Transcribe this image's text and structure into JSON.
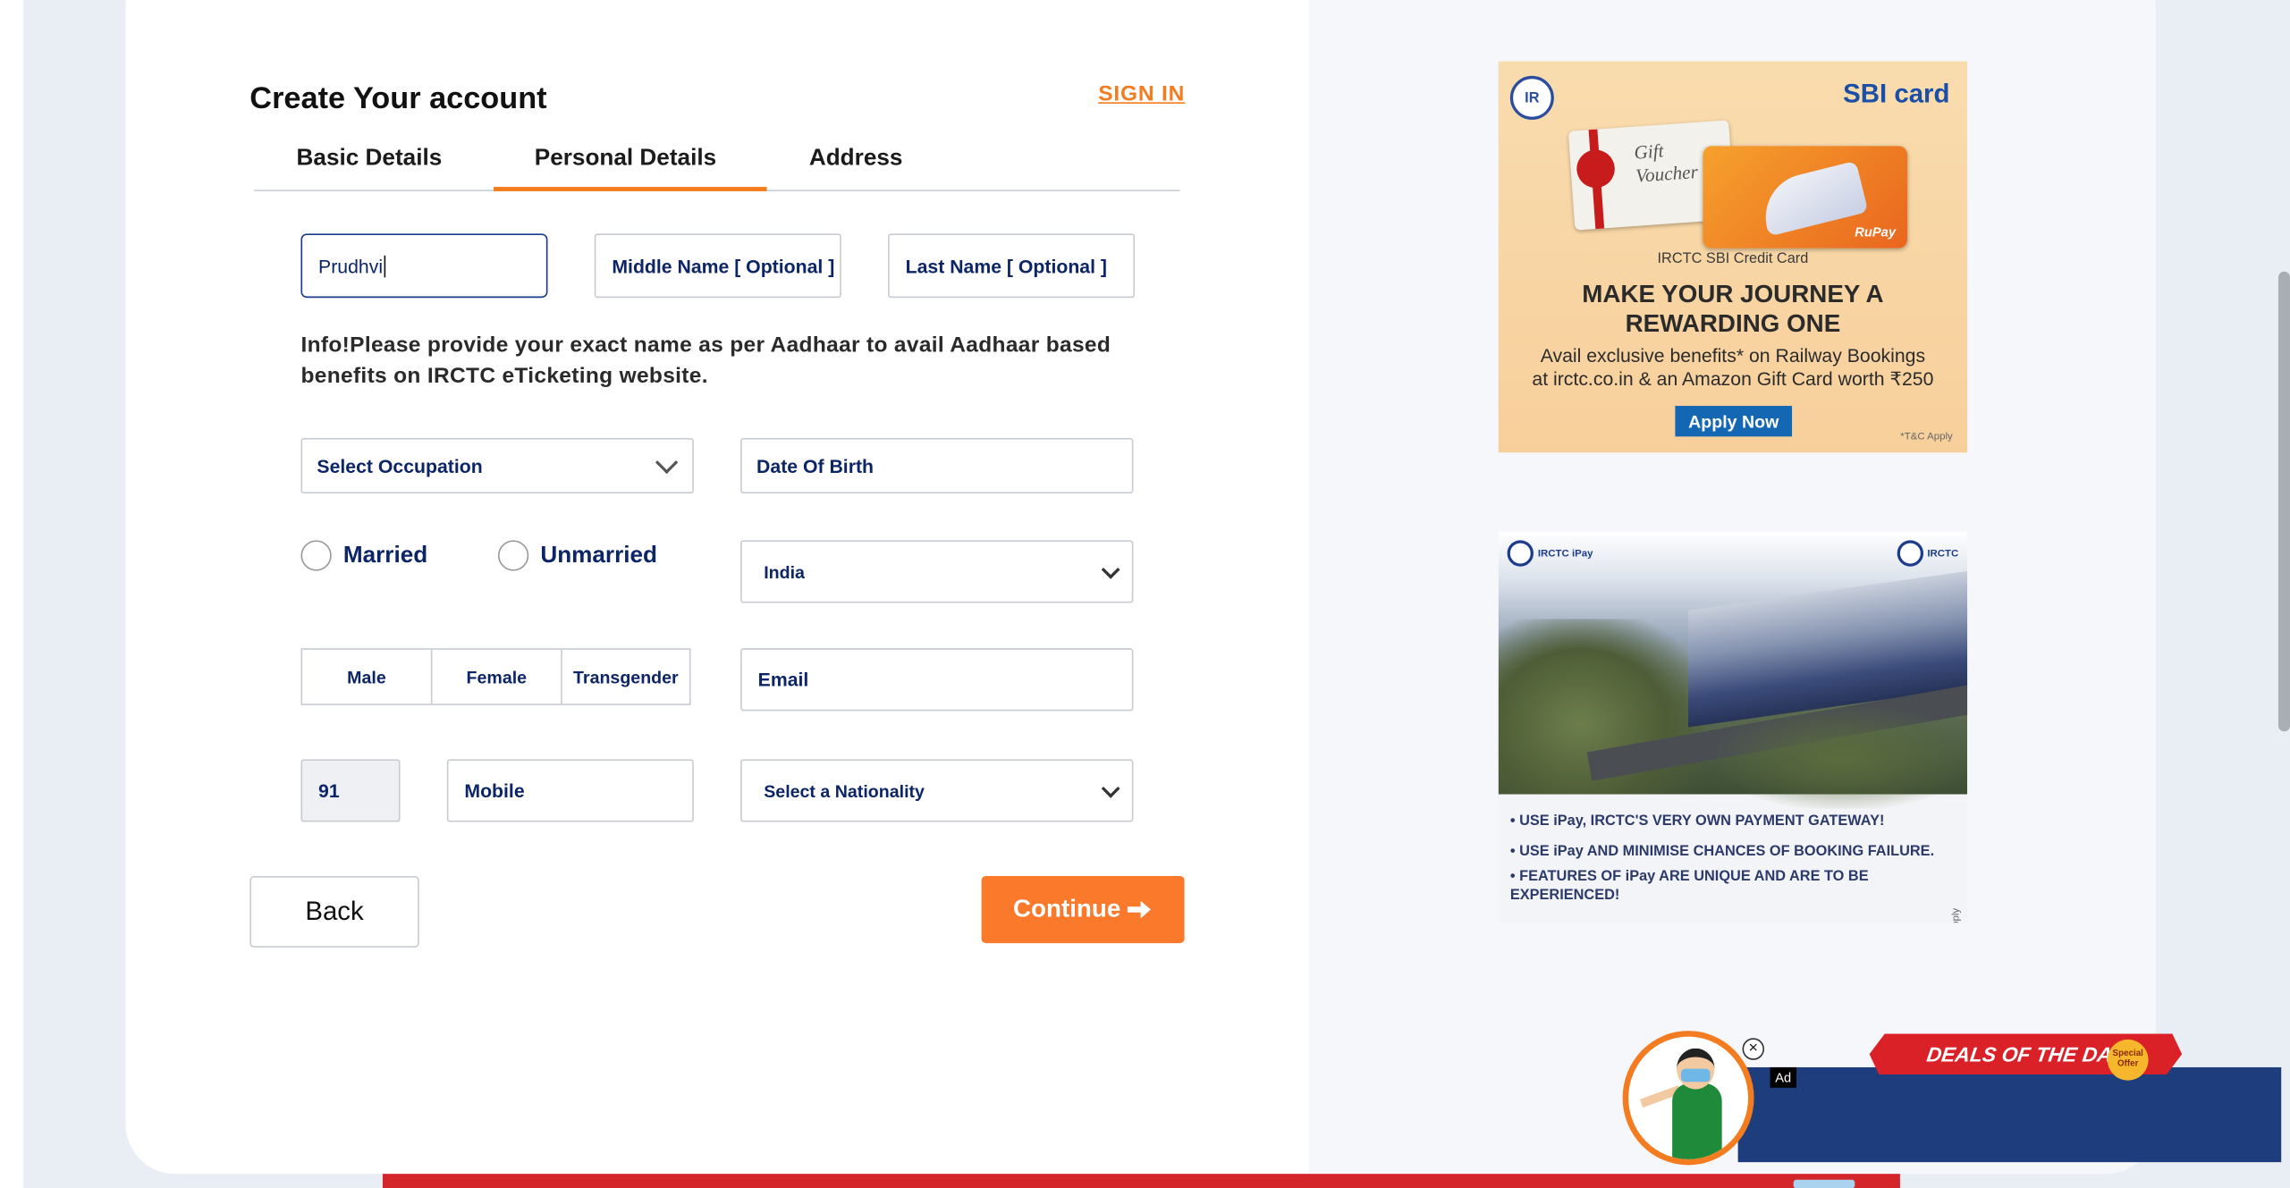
{
  "form": {
    "title": "Create Your account",
    "signin": "SIGN IN",
    "tabs": [
      "Basic Details",
      "Personal Details",
      "Address"
    ],
    "active_tab": "Personal Details",
    "first_name_value": "Prudhvi",
    "middle_name_placeholder": "Middle Name  [ Optional ]",
    "last_name_placeholder": "Last Name  [ Optional ]",
    "info": "Info!Please provide your exact name as per Aadhaar to avail Aadhaar based benefits on IRCTC eTicketing website.",
    "occupation": "Select Occupation",
    "dob": "Date Of Birth",
    "marital": [
      "Married",
      "Unmarried"
    ],
    "country": "India",
    "gender": [
      "Male",
      "Female",
      "Transgender"
    ],
    "email": "Email",
    "country_code": "91",
    "mobile": "Mobile",
    "nationality": "Select a Nationality",
    "back_label": "Back",
    "continue_label": "Continue",
    "continue_icon": "arrow-right-icon",
    "accent_color": "#f47c20",
    "field_text_color": "#0c2567"
  },
  "ads": {
    "sbi": {
      "brand": "SBI card",
      "voucher_text": "Gift Voucher",
      "card_badge": "RuPay",
      "caption": "IRCTC SBI Credit Card",
      "headline_1": "MAKE YOUR JOURNEY A",
      "headline_2": "REWARDING ONE",
      "sub_1": "Avail exclusive benefits* on Railway Bookings",
      "sub_2": "at irctc.co.in & an Amazon Gift Card worth ₹250",
      "apply": "Apply Now",
      "tc": "*T&C Apply"
    },
    "ipay": {
      "logo_left": "IRCTC iPay",
      "logo_right": "IRCTC",
      "bullet_1": "• USE iPay, IRCTC'S VERY OWN PAYMENT GATEWAY!",
      "bullet_2": "• USE iPay AND MINIMISE CHANCES OF BOOKING FAILURE.",
      "bullet_3": "• FEATURES OF iPay ARE UNIQUE AND ARE TO BE EXPERIENCED!",
      "tc": "T&C Apply"
    },
    "deals": {
      "banner": "DEALS OF THE DAY",
      "special": "Special Offer",
      "ad_tag": "Ad",
      "close": "×"
    }
  }
}
